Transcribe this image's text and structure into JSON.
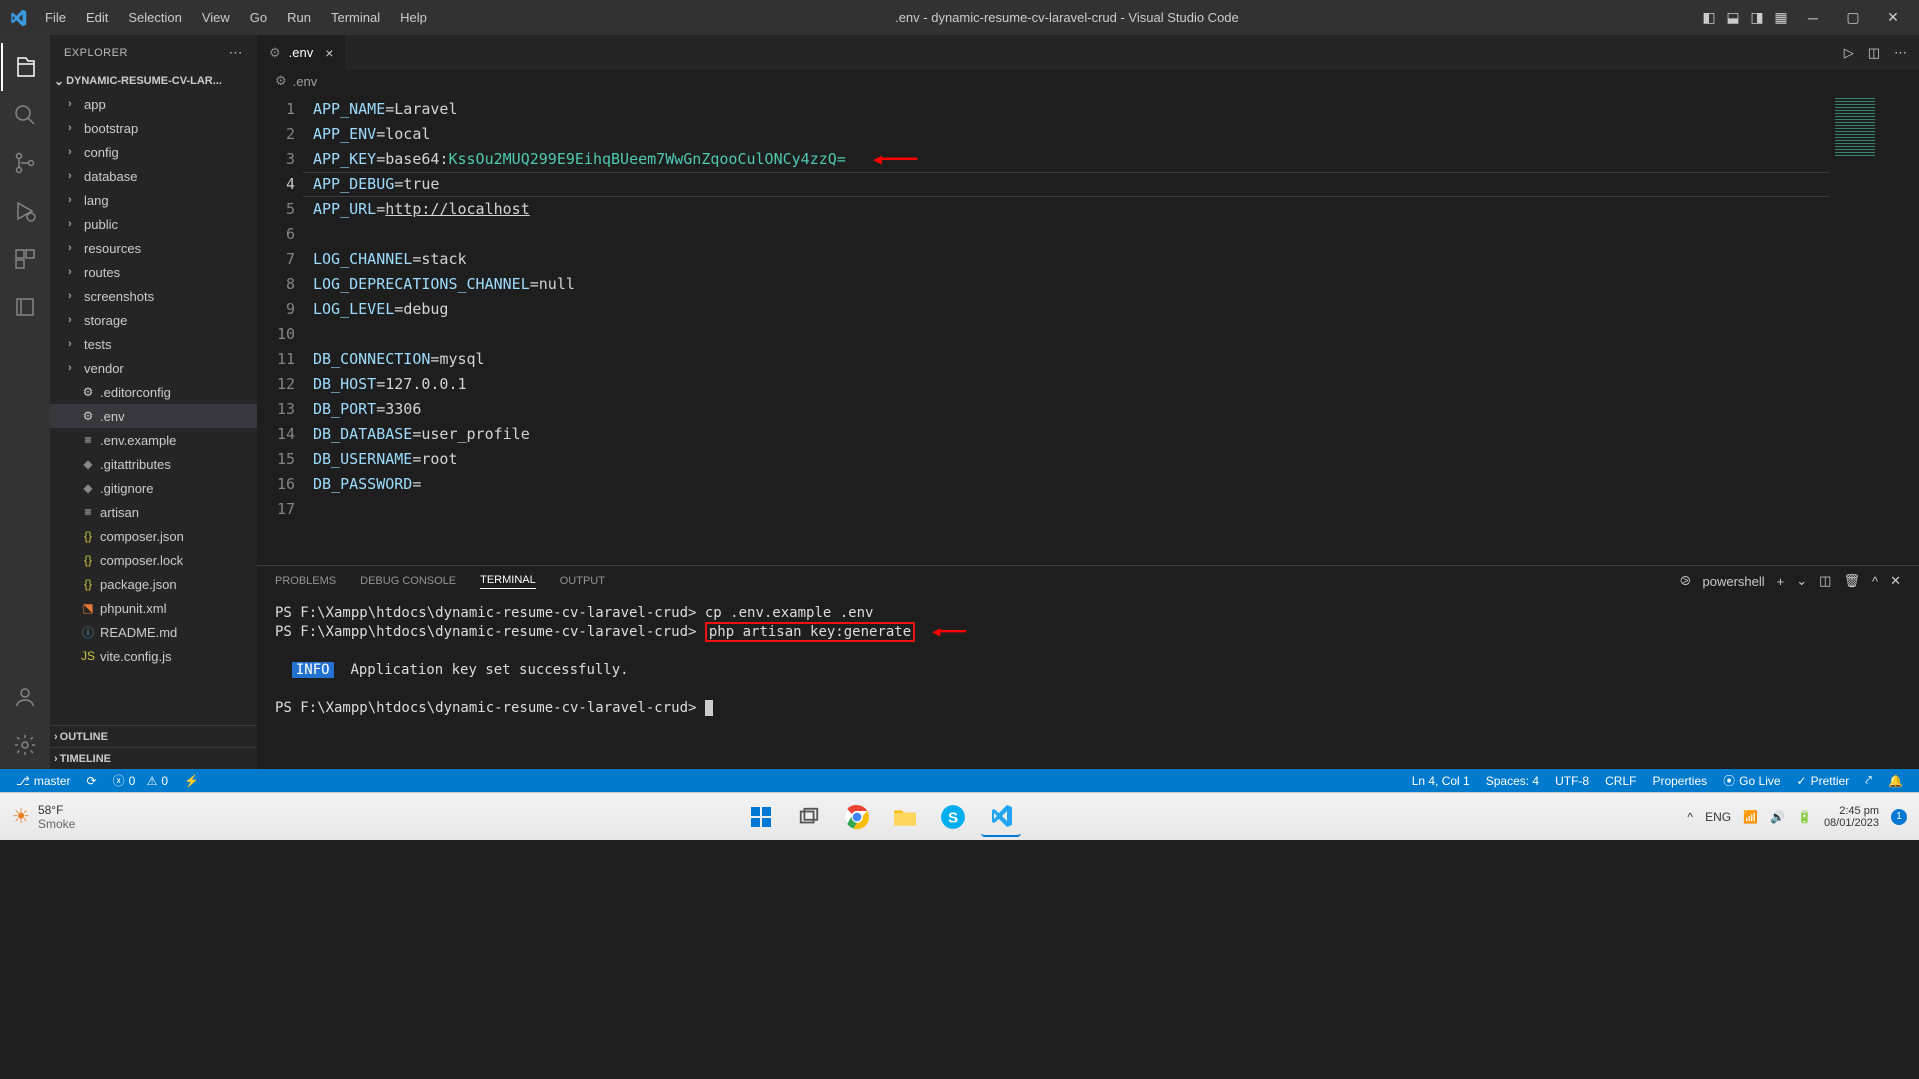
{
  "titlebar": {
    "title": ".env - dynamic-resume-cv-laravel-crud - Visual Studio Code",
    "menu": [
      "File",
      "Edit",
      "Selection",
      "View",
      "Go",
      "Run",
      "Terminal",
      "Help"
    ]
  },
  "sidebar": {
    "header": "EXPLORER",
    "folder": "DYNAMIC-RESUME-CV-LAR...",
    "folders": [
      "app",
      "bootstrap",
      "config",
      "database",
      "lang",
      "public",
      "resources",
      "routes",
      "screenshots",
      "storage",
      "tests",
      "vendor"
    ],
    "files": [
      {
        "name": ".editorconfig",
        "icon": "⚙",
        "color": "#cccccc"
      },
      {
        "name": ".env",
        "icon": "⚙",
        "color": "#cccccc",
        "selected": true
      },
      {
        "name": ".env.example",
        "icon": "≡",
        "color": "#cccccc"
      },
      {
        "name": ".gitattributes",
        "icon": "◆",
        "color": "#888"
      },
      {
        "name": ".gitignore",
        "icon": "◆",
        "color": "#888"
      },
      {
        "name": "artisan",
        "icon": "≡",
        "color": "#cccccc"
      },
      {
        "name": "composer.json",
        "icon": "{}",
        "color": "#cbcb41"
      },
      {
        "name": "composer.lock",
        "icon": "{}",
        "color": "#cbcb41"
      },
      {
        "name": "package.json",
        "icon": "{}",
        "color": "#cbcb41"
      },
      {
        "name": "phpunit.xml",
        "icon": "⬔",
        "color": "#e37933"
      },
      {
        "name": "README.md",
        "icon": "ⓘ",
        "color": "#519aba"
      },
      {
        "name": "vite.config.js",
        "icon": "JS",
        "color": "#cbcb41"
      }
    ],
    "sections": [
      "OUTLINE",
      "TIMELINE"
    ]
  },
  "tabs": {
    "open": ".env"
  },
  "breadcrumb": ".env",
  "code_lines": [
    {
      "n": 1,
      "var": "APP_NAME",
      "val": "Laravel"
    },
    {
      "n": 2,
      "var": "APP_ENV",
      "val": "local"
    },
    {
      "n": 3,
      "var": "APP_KEY",
      "val": "base64:",
      "key": "KssOu2MUQ299E9EihqBUeem7WwGnZqooCulONCy4zzQ=",
      "arrow": true
    },
    {
      "n": 4,
      "var": "APP_DEBUG",
      "val": "true",
      "hl": true
    },
    {
      "n": 5,
      "var": "APP_URL",
      "val": "",
      "url": "http://localhost"
    },
    {
      "n": 6,
      "blank": true
    },
    {
      "n": 7,
      "var": "LOG_CHANNEL",
      "val": "stack"
    },
    {
      "n": 8,
      "var": "LOG_DEPRECATIONS_CHANNEL",
      "val": "null"
    },
    {
      "n": 9,
      "var": "LOG_LEVEL",
      "val": "debug"
    },
    {
      "n": 10,
      "blank": true
    },
    {
      "n": 11,
      "var": "DB_CONNECTION",
      "val": "mysql"
    },
    {
      "n": 12,
      "var": "DB_HOST",
      "val": "127.0.0.1"
    },
    {
      "n": 13,
      "var": "DB_PORT",
      "val": "3306"
    },
    {
      "n": 14,
      "var": "DB_DATABASE",
      "val": "user_profile"
    },
    {
      "n": 15,
      "var": "DB_USERNAME",
      "val": "root"
    },
    {
      "n": 16,
      "var": "DB_PASSWORD",
      "val": ""
    },
    {
      "n": 17,
      "blank": true
    }
  ],
  "panel": {
    "tabs": [
      "PROBLEMS",
      "DEBUG CONSOLE",
      "TERMINAL",
      "OUTPUT"
    ],
    "active": "TERMINAL",
    "shell": "powershell",
    "prompt": "PS F:\\Xampp\\htdocs\\dynamic-resume-cv-laravel-crud>",
    "cmd1": "cp .env.example .env",
    "cmd2": "php artisan key:generate",
    "info_label": "INFO",
    "info_msg": "Application key set successfully."
  },
  "status": {
    "branch": "master",
    "errors": "0",
    "warnings": "0",
    "pos": "Ln 4, Col 1",
    "spaces": "Spaces: 4",
    "encoding": "UTF-8",
    "eol": "CRLF",
    "lang": "Properties",
    "golive": "Go Live",
    "prettier": "Prettier"
  },
  "taskbar": {
    "temp": "58°F",
    "cond": "Smoke",
    "lang": "ENG",
    "time": "2:45 pm",
    "date": "08/01/2023",
    "badge": "1"
  }
}
